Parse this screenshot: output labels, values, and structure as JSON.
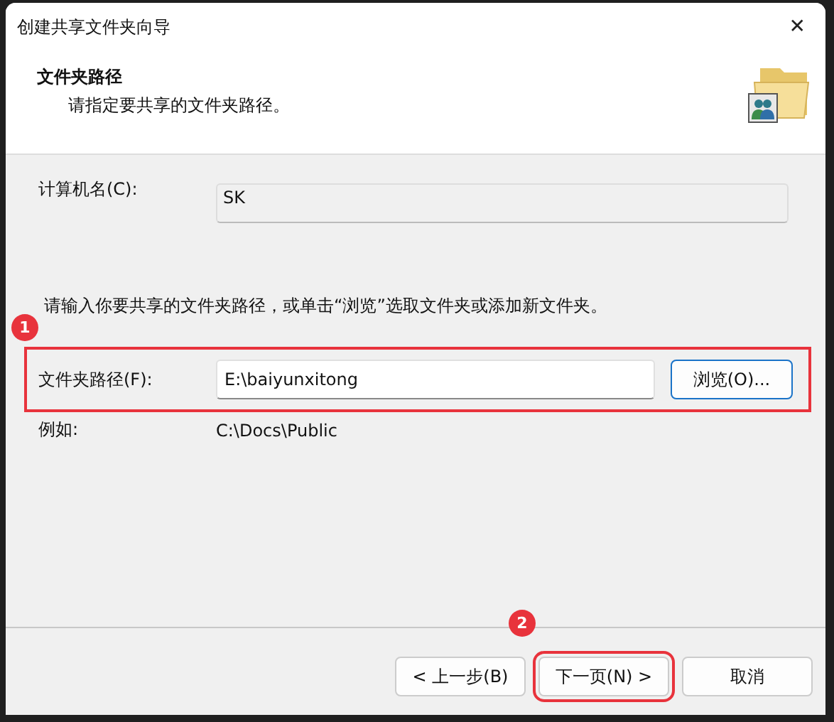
{
  "window": {
    "title": "创建共享文件夹向导",
    "close": "✕"
  },
  "header": {
    "title": "文件夹路径",
    "subtitle": "请指定要共享的文件夹路径。"
  },
  "computer": {
    "label": "计算机名(C):",
    "value": "SK"
  },
  "instruction": "请输入你要共享的文件夹路径，或单击“浏览”选取文件夹或添加新文件夹。",
  "path": {
    "label": "文件夹路径(F):",
    "value": "E:\\baiyunxitong",
    "browse": "浏览(O)..."
  },
  "example": {
    "label": "例如:",
    "value": "C:\\Docs\\Public"
  },
  "buttons": [
    {
      "label": "< 上一步(B)",
      "highlighted": false
    },
    {
      "label": "下一页(N) >",
      "highlighted": true
    },
    {
      "label": "取消",
      "highlighted": false
    }
  ],
  "annotations": [
    {
      "number": "1"
    },
    {
      "number": "2"
    }
  ]
}
